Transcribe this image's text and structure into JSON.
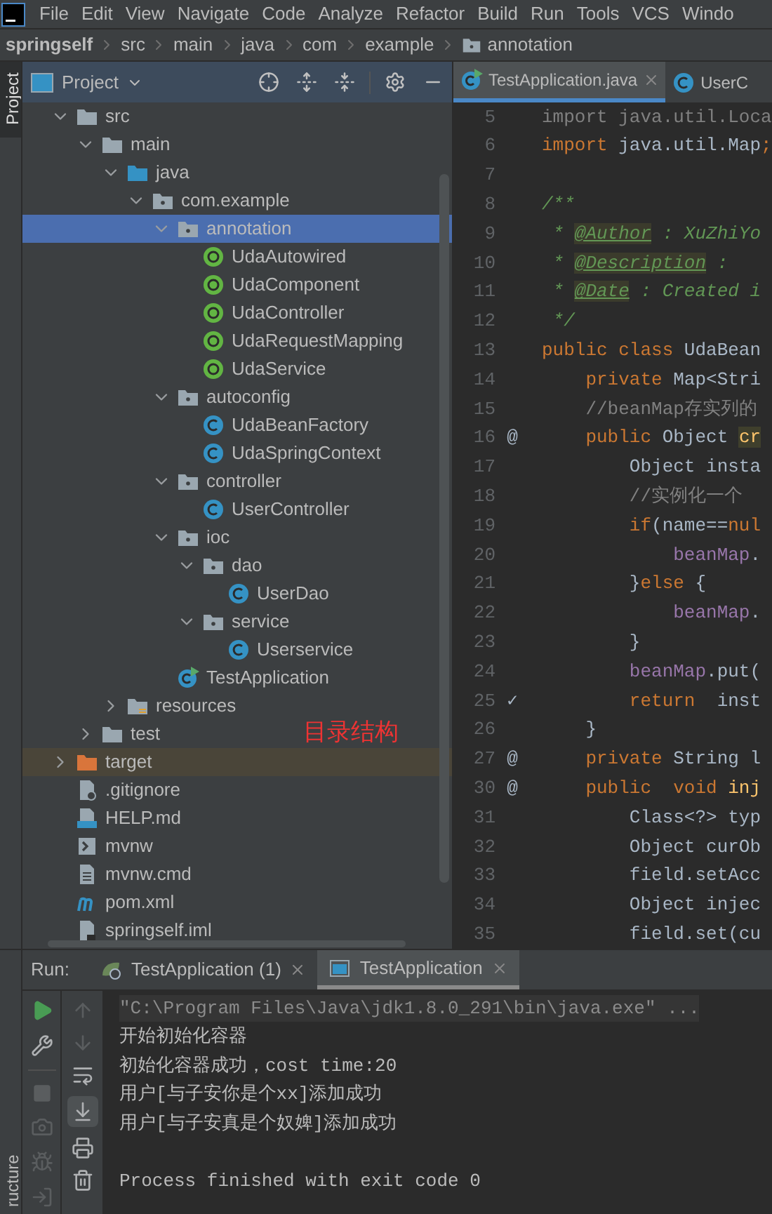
{
  "menu": [
    "File",
    "Edit",
    "View",
    "Navigate",
    "Code",
    "Analyze",
    "Refactor",
    "Build",
    "Run",
    "Tools",
    "VCS",
    "Windo"
  ],
  "breadcrumb": [
    {
      "label": "springself",
      "kind": "project"
    },
    {
      "label": "src",
      "kind": "dir"
    },
    {
      "label": "main",
      "kind": "dir"
    },
    {
      "label": "java",
      "kind": "dir"
    },
    {
      "label": "com",
      "kind": "dir"
    },
    {
      "label": "example",
      "kind": "dir"
    },
    {
      "label": "annotation",
      "kind": "package"
    }
  ],
  "side_tabs": [
    {
      "label": "Project",
      "selected": true
    },
    {
      "label": "ructure",
      "selected": false
    }
  ],
  "project_panel": {
    "title": "Project",
    "tree": [
      {
        "label": "src",
        "kind": "folder",
        "expanded": true,
        "selected": false,
        "children": [
          {
            "label": "main",
            "kind": "folder",
            "expanded": true,
            "selected": false,
            "children": [
              {
                "label": "java",
                "kind": "source-root",
                "expanded": true,
                "selected": false,
                "children": [
                  {
                    "label": "com.example",
                    "kind": "package",
                    "expanded": true,
                    "selected": false,
                    "children": [
                      {
                        "label": "annotation",
                        "kind": "package",
                        "expanded": true,
                        "selected": true,
                        "children": [
                          {
                            "label": "UdaAutowired",
                            "kind": "annotation",
                            "selected": false
                          },
                          {
                            "label": "UdaComponent",
                            "kind": "annotation",
                            "selected": false
                          },
                          {
                            "label": "UdaController",
                            "kind": "annotation",
                            "selected": false
                          },
                          {
                            "label": "UdaRequestMapping",
                            "kind": "annotation",
                            "selected": false
                          },
                          {
                            "label": "UdaService",
                            "kind": "annotation",
                            "selected": false
                          }
                        ]
                      },
                      {
                        "label": "autoconfig",
                        "kind": "package",
                        "expanded": true,
                        "selected": false,
                        "children": [
                          {
                            "label": "UdaBeanFactory",
                            "kind": "class",
                            "selected": false
                          },
                          {
                            "label": "UdaSpringContext",
                            "kind": "class",
                            "selected": false
                          }
                        ]
                      },
                      {
                        "label": "controller",
                        "kind": "package",
                        "expanded": true,
                        "selected": false,
                        "children": [
                          {
                            "label": "UserController",
                            "kind": "class",
                            "selected": false
                          }
                        ]
                      },
                      {
                        "label": "ioc",
                        "kind": "package",
                        "expanded": true,
                        "selected": false,
                        "children": [
                          {
                            "label": "dao",
                            "kind": "package",
                            "expanded": true,
                            "selected": false,
                            "children": [
                              {
                                "label": "UserDao",
                                "kind": "class",
                                "selected": false
                              }
                            ]
                          },
                          {
                            "label": "service",
                            "kind": "package",
                            "expanded": true,
                            "selected": false,
                            "children": [
                              {
                                "label": "Userservice",
                                "kind": "class",
                                "selected": false
                              }
                            ]
                          }
                        ]
                      },
                      {
                        "label": "TestApplication",
                        "kind": "main-class",
                        "selected": false
                      }
                    ]
                  }
                ]
              },
              {
                "label": "resources",
                "kind": "resources",
                "expanded": false,
                "selected": false
              }
            ]
          },
          {
            "label": "test",
            "kind": "folder",
            "expanded": false,
            "selected": false
          }
        ]
      },
      {
        "label": "target",
        "kind": "excluded",
        "expanded": false,
        "selected": false
      },
      {
        "label": ".gitignore",
        "kind": "ignore-file",
        "selected": false
      },
      {
        "label": "HELP.md",
        "kind": "markdown-file",
        "selected": false
      },
      {
        "label": "mvnw",
        "kind": "shell-file",
        "selected": false
      },
      {
        "label": "mvnw.cmd",
        "kind": "text-file",
        "selected": false
      },
      {
        "label": "pom.xml",
        "kind": "maven-file",
        "selected": false
      },
      {
        "label": "springself.iml",
        "kind": "module-file",
        "selected": false
      }
    ],
    "note": "目录结构"
  },
  "editor": {
    "tabs": [
      {
        "label": "TestApplication.java",
        "kind": "main-class",
        "selected": true
      },
      {
        "label": "UserC",
        "kind": "class",
        "selected": false
      }
    ],
    "lines": [
      {
        "number": "5",
        "segments": [
          {
            "text": "import java.util.Loca",
            "kind": "unused"
          }
        ]
      },
      {
        "number": "6",
        "segments": [
          {
            "text": "import",
            "kind": "kw"
          },
          {
            "text": " java.util.Map",
            "kind": "plain"
          },
          {
            "text": ";",
            "kind": "kw"
          }
        ]
      },
      {
        "number": "7"
      },
      {
        "number": "8",
        "segments": [
          {
            "text": "/**",
            "kind": "doc"
          }
        ]
      },
      {
        "number": "9",
        "segments": [
          {
            "text": " * ",
            "kind": "doc"
          },
          {
            "text": "@Author",
            "kind": "tag"
          },
          {
            "text": " : XuZhiYo",
            "kind": "doc"
          }
        ]
      },
      {
        "number": "10",
        "segments": [
          {
            "text": " * ",
            "kind": "doc"
          },
          {
            "text": "@Description",
            "kind": "tag"
          },
          {
            "text": " :",
            "kind": "doc"
          }
        ]
      },
      {
        "number": "11",
        "segments": [
          {
            "text": " * ",
            "kind": "doc"
          },
          {
            "text": "@Date",
            "kind": "tag"
          },
          {
            "text": " : Created i",
            "kind": "doc"
          }
        ]
      },
      {
        "number": "12",
        "segments": [
          {
            "text": " */",
            "kind": "doc"
          }
        ]
      },
      {
        "number": "13",
        "segments": [
          {
            "text": "public class",
            "kind": "kw"
          },
          {
            "text": " UdaBean",
            "kind": "plain"
          }
        ]
      },
      {
        "number": "14",
        "segments": [
          {
            "text": "    private",
            "kind": "kw"
          },
          {
            "text": " Map<Stri",
            "kind": "plain"
          }
        ]
      },
      {
        "number": "15",
        "segments": [
          {
            "text": "    //beanMap存实列的",
            "kind": "comment"
          }
        ]
      },
      {
        "number": "16",
        "gutter": "@",
        "segments": [
          {
            "text": "    public",
            "kind": "kw"
          },
          {
            "text": " Object ",
            "kind": "plain"
          },
          {
            "text": "cr",
            "kind": "method-hl"
          }
        ]
      },
      {
        "number": "17",
        "segments": [
          {
            "text": "        Object insta",
            "kind": "plain"
          }
        ]
      },
      {
        "number": "18",
        "segments": [
          {
            "text": "        //实例化一个",
            "kind": "comment"
          }
        ]
      },
      {
        "number": "19",
        "segments": [
          {
            "text": "        if",
            "kind": "kw"
          },
          {
            "text": "(name==",
            "kind": "plain"
          },
          {
            "text": "nul",
            "kind": "kw"
          }
        ]
      },
      {
        "number": "20",
        "segments": [
          {
            "text": "            beanMap",
            "kind": "field"
          },
          {
            "text": ".",
            "kind": "plain"
          }
        ]
      },
      {
        "number": "21",
        "segments": [
          {
            "text": "        }",
            "kind": "plain"
          },
          {
            "text": "else",
            "kind": "kw"
          },
          {
            "text": " {",
            "kind": "plain"
          }
        ]
      },
      {
        "number": "22",
        "segments": [
          {
            "text": "            beanMap",
            "kind": "field"
          },
          {
            "text": ".",
            "kind": "plain"
          }
        ]
      },
      {
        "number": "23",
        "segments": [
          {
            "text": "        }",
            "kind": "plain"
          }
        ]
      },
      {
        "number": "24",
        "segments": [
          {
            "text": "        beanMap",
            "kind": "field"
          },
          {
            "text": ".put(",
            "kind": "plain"
          }
        ]
      },
      {
        "number": "25",
        "gutter": "✓",
        "segments": [
          {
            "text": "        return",
            "kind": "kw"
          },
          {
            "text": "  inst",
            "kind": "plain"
          }
        ]
      },
      {
        "number": "26",
        "segments": [
          {
            "text": "    }",
            "kind": "plain"
          }
        ]
      },
      {
        "number": "27",
        "gutter": "@",
        "segments": [
          {
            "text": "    private",
            "kind": "kw"
          },
          {
            "text": " String l",
            "kind": "plain"
          }
        ]
      },
      {
        "number": "30",
        "gutter": "@",
        "segments": [
          {
            "text": "    public  void",
            "kind": "kw"
          },
          {
            "text": " inj",
            "kind": "method"
          }
        ]
      },
      {
        "number": "31",
        "segments": [
          {
            "text": "        Class<?> typ",
            "kind": "plain"
          }
        ]
      },
      {
        "number": "32",
        "segments": [
          {
            "text": "        Object curOb",
            "kind": "plain"
          }
        ]
      },
      {
        "number": "33",
        "segments": [
          {
            "text": "        field.setAcc",
            "kind": "plain"
          }
        ]
      },
      {
        "number": "34",
        "segments": [
          {
            "text": "        Object injec",
            "kind": "plain"
          }
        ]
      },
      {
        "number": "35",
        "segments": [
          {
            "text": "        field.set(cu",
            "kind": "plain"
          }
        ]
      }
    ]
  },
  "run_panel": {
    "label": "Run:",
    "tabs": [
      {
        "label": "TestApplication (1)",
        "kind": "spring",
        "selected": false
      },
      {
        "label": "TestApplication",
        "kind": "console",
        "selected": true
      }
    ],
    "output": [
      {
        "text": "\"C:\\Program Files\\Java\\jdk1.8.0_291\\bin\\java.exe\" ...",
        "kind": "command"
      },
      {
        "text": "开始初始化容器",
        "kind": "out"
      },
      {
        "text": "初始化容器成功，cost time:20",
        "kind": "out"
      },
      {
        "text": "用户[与子安你是个xx]添加成功",
        "kind": "out"
      },
      {
        "text": "用户[与子安真是个奴婢]添加成功",
        "kind": "out"
      },
      {
        "kind": "blank"
      },
      {
        "text": "Process finished with exit code 0",
        "kind": "out"
      }
    ]
  }
}
